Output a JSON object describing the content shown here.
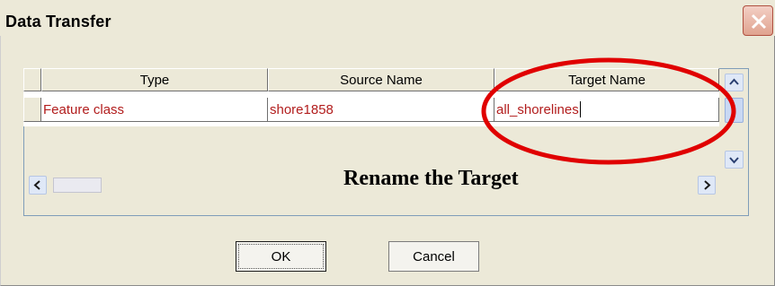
{
  "window": {
    "title": "Data Transfer"
  },
  "grid": {
    "columns": [
      "Type",
      "Source Name",
      "Target Name"
    ],
    "rows": [
      {
        "type": "Feature class",
        "source_name": "shore1858",
        "target_name": "all_shorelines"
      }
    ]
  },
  "annotation": {
    "text": "Rename the Target",
    "highlight_color": "#e00000"
  },
  "buttons": {
    "ok": "OK",
    "cancel": "Cancel"
  }
}
